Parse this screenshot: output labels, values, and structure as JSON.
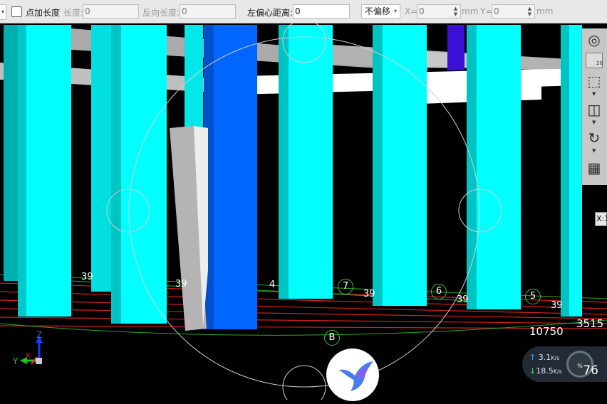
{
  "toolbar": {
    "add_length_label": "点加长度",
    "length_label": "长度:",
    "length_value": "0",
    "reverse_length_label": "反向长度:",
    "reverse_length_value": "0",
    "left_offset_label": "左偏心距离:",
    "left_offset_value": "0",
    "offset_mode": "不偏移",
    "x_label": "X=",
    "x_value": "0",
    "x_unit": "mm",
    "y_label": "Y=",
    "y_value": "0",
    "y_unit": "mm"
  },
  "viewport": {
    "grid_labels": [
      "7",
      "6",
      "5",
      "B"
    ],
    "partial_labels": [
      "39",
      "39",
      "39",
      "39",
      "39",
      "4"
    ],
    "dimension_primary": "10750",
    "dimension_secondary": "3515",
    "axis_z": "Z",
    "axis_y": "Y",
    "axis_x": "X"
  },
  "view_panel": {
    "scale_label": "20"
  },
  "tooltip_x": "X:1",
  "network_widget": {
    "upload": "3.1",
    "upload_unit": "K/s",
    "download": "18.5",
    "download_unit": "K/s",
    "percent": "76",
    "percent_unit": "%"
  },
  "icons": [
    "dropdown-arrow-icon",
    "checkbox-icon",
    "sphere-view-icon",
    "2d-view-icon",
    "cube-view-icon",
    "box-view-icon",
    "rotate-icon",
    "grid-view-icon",
    "hummingbird-logo-icon"
  ]
}
